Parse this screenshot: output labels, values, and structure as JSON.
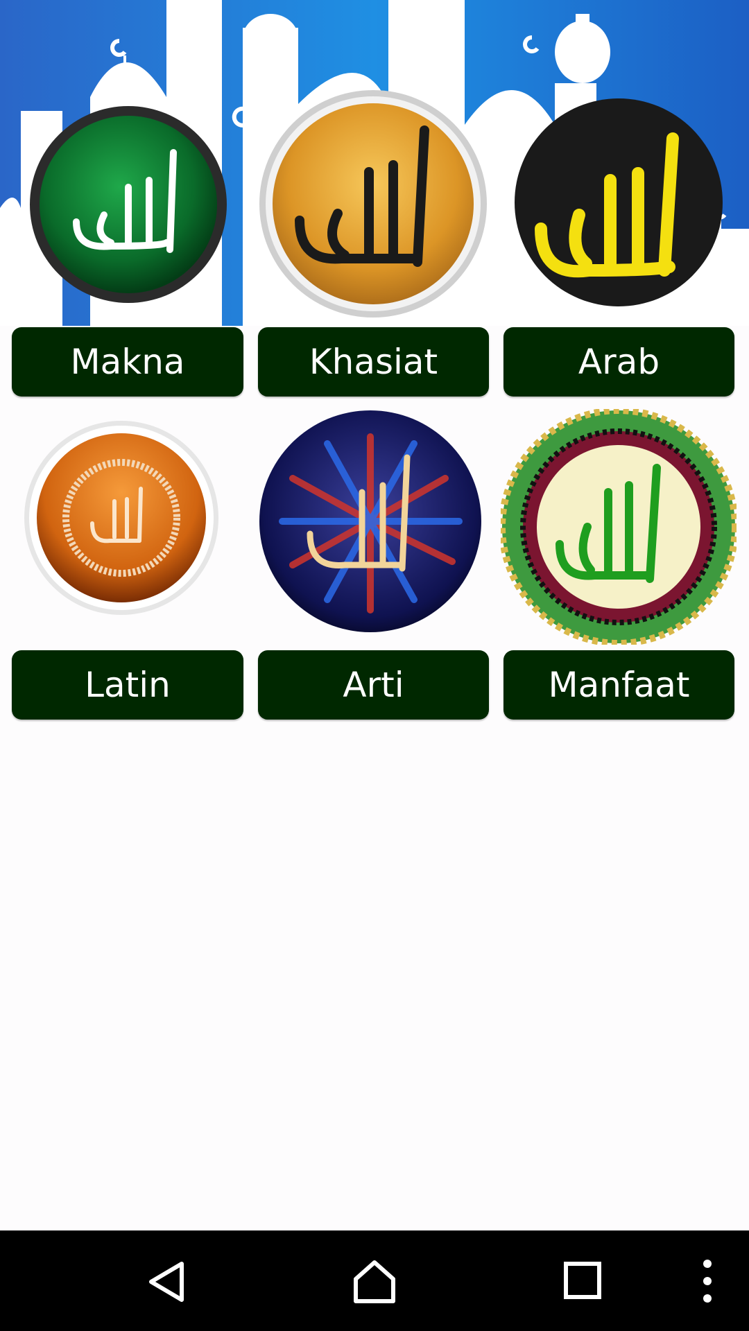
{
  "colors": {
    "sky_blue": "#1a73d0",
    "button_bg": "#002800",
    "button_text": "#ffffff",
    "nav_bar": "#000000"
  },
  "menu": {
    "row1": [
      {
        "label": "Makna",
        "icon": "allah-green-medallion-icon"
      },
      {
        "label": "Khasiat",
        "icon": "allah-gold-medallion-icon"
      },
      {
        "label": "Arab",
        "icon": "allah-yellow-black-medallion-icon"
      }
    ],
    "row2": [
      {
        "label": "Latin",
        "icon": "allah-orange-medallion-icon"
      },
      {
        "label": "Arti",
        "icon": "allah-starburst-medallion-icon"
      },
      {
        "label": "Manfaat",
        "icon": "allah-ornate-medallion-icon"
      }
    ]
  },
  "navigation": {
    "back": "back-icon",
    "home": "home-icon",
    "recents": "recents-icon",
    "overflow": "overflow-menu-icon"
  }
}
